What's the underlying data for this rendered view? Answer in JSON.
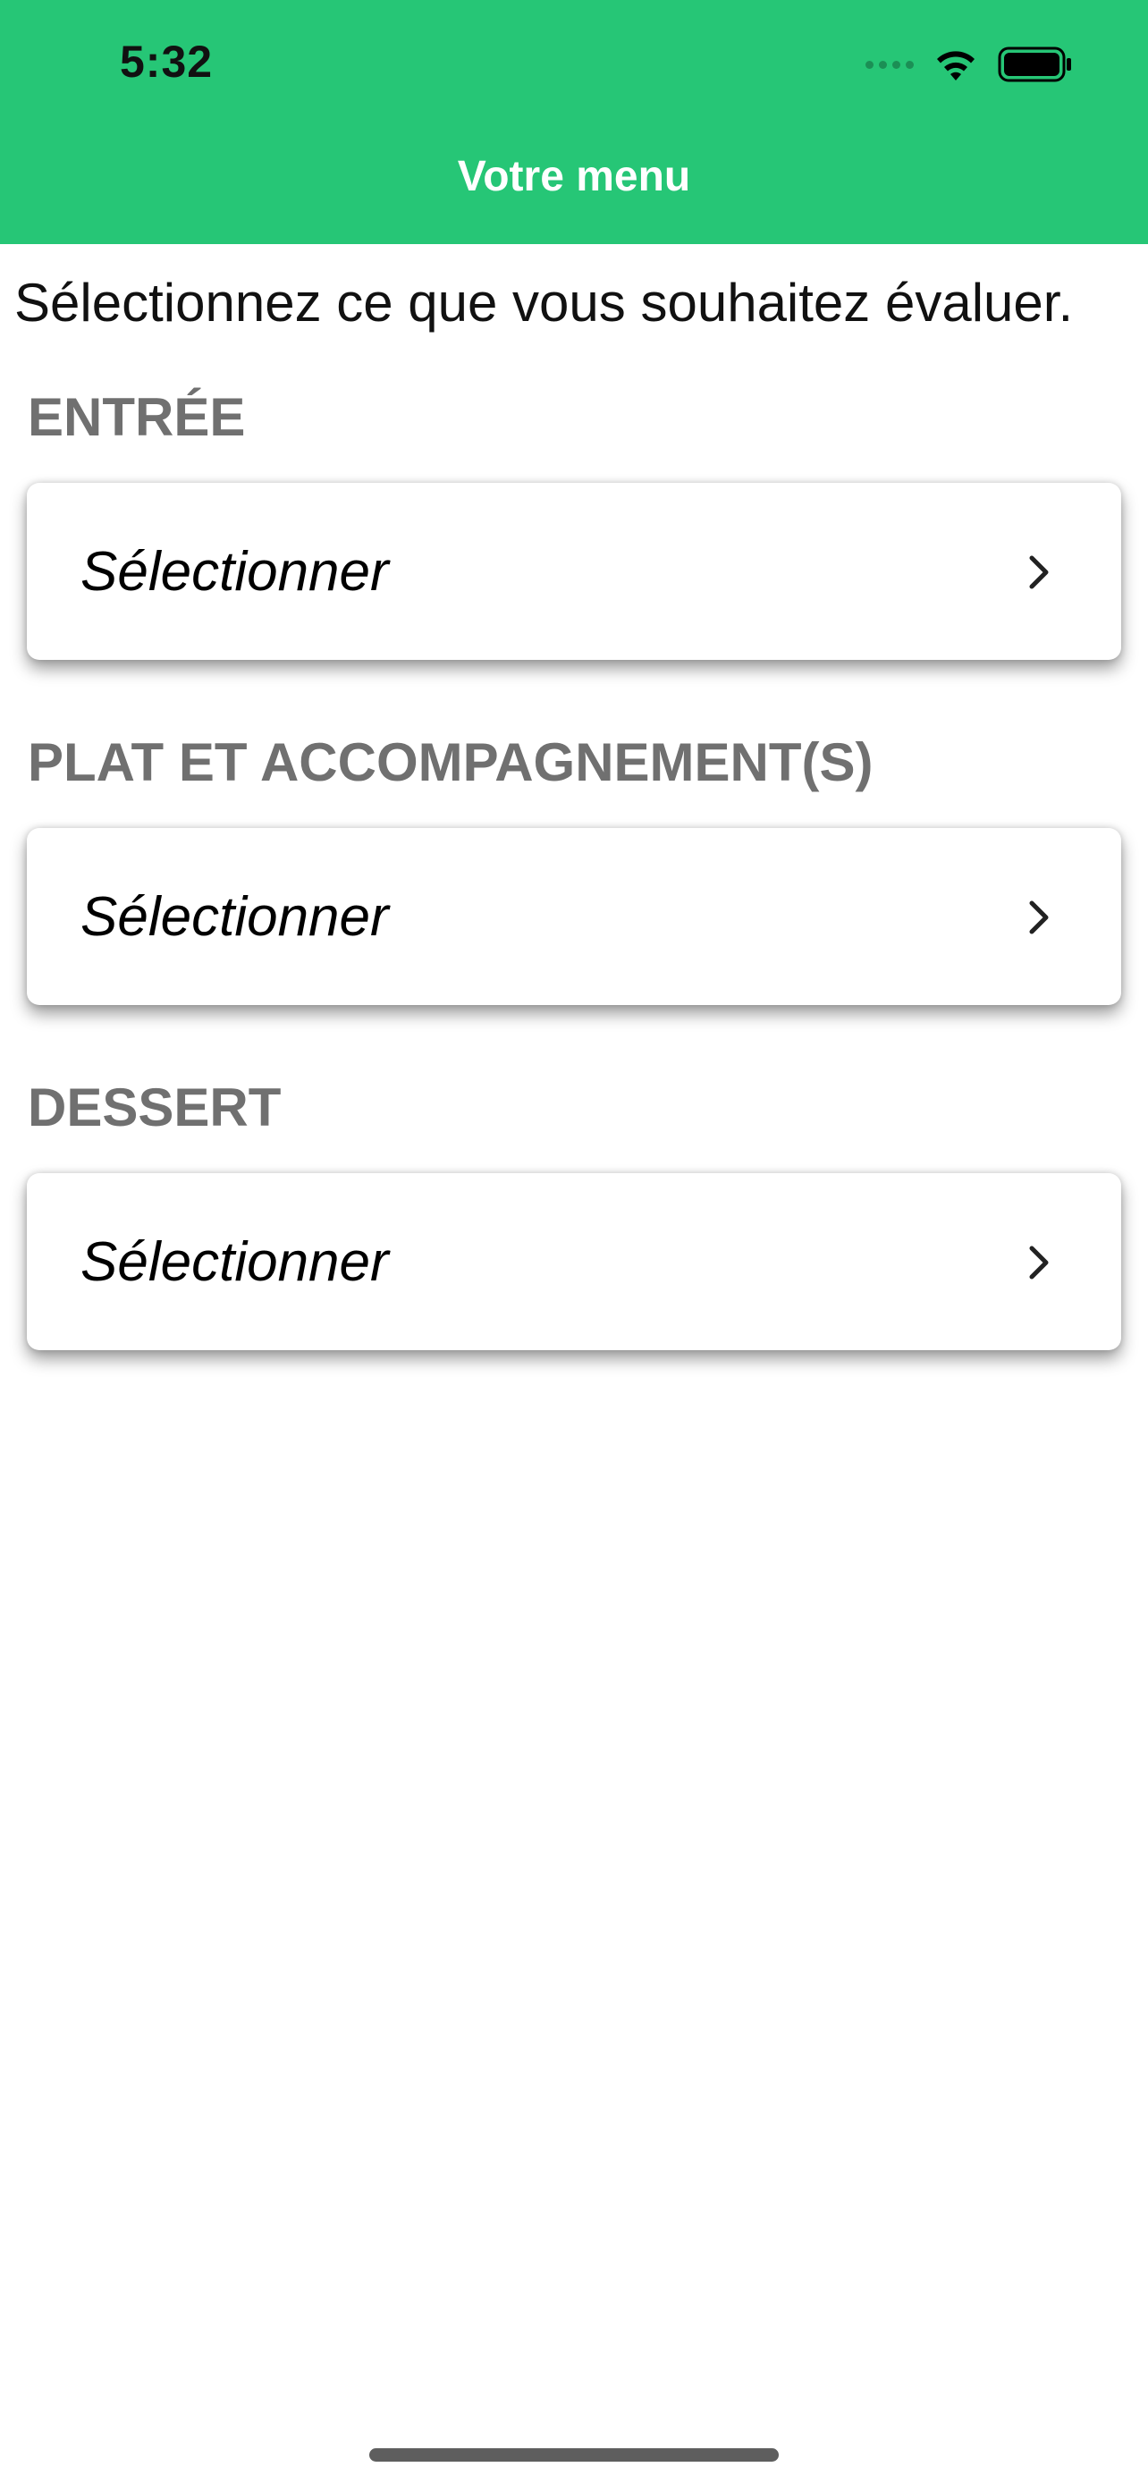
{
  "status_bar": {
    "time": "5:32",
    "icons": [
      "signal-dots-icon",
      "wifi-icon",
      "battery-icon"
    ]
  },
  "nav": {
    "title": "Votre menu",
    "background_color": "#26c676"
  },
  "intro_text": "Sélectionnez ce que vous souhaitez évaluer.",
  "sections": [
    {
      "label": "ENTRÉE",
      "selector_text": "Sélectionner",
      "icon": "chevron-right-icon"
    },
    {
      "label": "PLAT ET ACCOMPAGNEMENT(S)",
      "selector_text": "Sélectionner",
      "icon": "chevron-right-icon"
    },
    {
      "label": "DESSERT",
      "selector_text": "Sélectionner",
      "icon": "chevron-right-icon"
    }
  ]
}
